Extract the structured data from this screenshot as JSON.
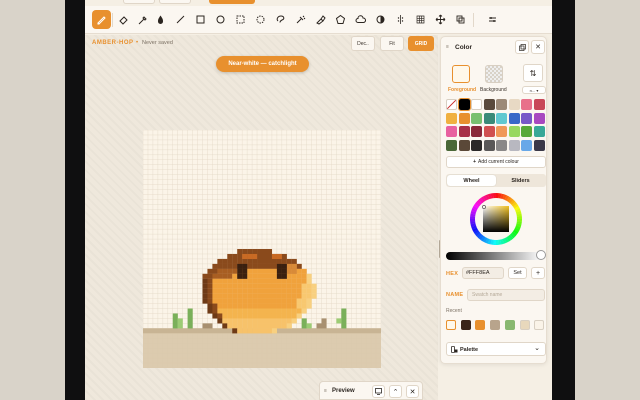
{
  "colors": {
    "accent": "#e8902e",
    "canvas_bg": "#fbf4e8",
    "ground": "#d8c6a8",
    "grid": "#e3d8c6"
  },
  "toolbar": {
    "tools": [
      {
        "name": "pencil-icon",
        "active": true
      },
      {
        "name": "eraser-icon"
      },
      {
        "name": "eyedropper-icon"
      },
      {
        "name": "fill-drop-icon"
      },
      {
        "name": "line-icon"
      },
      {
        "name": "rectangle-icon"
      },
      {
        "name": "circle-icon"
      },
      {
        "name": "select-rect-icon"
      },
      {
        "name": "select-ellipse-icon"
      },
      {
        "name": "lasso-icon"
      },
      {
        "name": "dither-brush-icon"
      },
      {
        "name": "smudge-icon"
      },
      {
        "name": "polygon-icon"
      },
      {
        "name": "cloud-shape-icon"
      },
      {
        "name": "contrast-icon"
      },
      {
        "name": "symmetry-icon"
      },
      {
        "name": "grid-pattern-icon"
      },
      {
        "name": "move-icon"
      },
      {
        "name": "layers-icon"
      },
      {
        "name": "adjust-icon"
      }
    ]
  },
  "document": {
    "title": "AMBER-HOP",
    "separator": "•",
    "status": "Never saved"
  },
  "view_buttons": {
    "dec": "Dec..",
    "fit": "Fit",
    "grid": "GRID"
  },
  "tooltip": {
    "text": "Near-white — catchlight"
  },
  "panel": {
    "title": "Color",
    "foreground_label": "Foreground",
    "background_label": "Background",
    "foreground_color": "#fff8ea",
    "mode_label": "n... ▾",
    "swatches": [
      "checker",
      "#000000",
      "#ffffff",
      "#5a4a3c",
      "#9c8a78",
      "#e8d9c4",
      "#e8708a",
      "#c84858",
      "#f0b040",
      "#e8902e",
      "#78c070",
      "#3a8a78",
      "#60c8d0",
      "#3868c8",
      "#7858c8",
      "#a848c0",
      "#e860a0",
      "#a83048",
      "#8a2838",
      "#d05050",
      "#f09858",
      "#98d860",
      "#58a838",
      "#38a898",
      "#4a6838",
      "#5a4838",
      "#2a2828",
      "#5a5858",
      "#8a8888",
      "#b8b8c0",
      "#68a8e8",
      "#3a3848"
    ],
    "add_colour_label": "Add current colour",
    "tabs": [
      {
        "label": "Wheel",
        "active": true
      },
      {
        "label": "Sliders",
        "active": false
      }
    ],
    "hex_label": "HEX",
    "hex_value": "#FFF8EA",
    "set_label": "Set",
    "plus_label": "+",
    "name_label": "NAME",
    "name_placeholder": "Swatch name",
    "recent_label": "Recent",
    "recent": [
      "#fff8ea",
      "#3a2418",
      "#e8902e",
      "#b8a48c",
      "#88b870",
      "#e8d8bc",
      "#faf3e8"
    ],
    "palette_label": "Palette",
    "palette_chevron": "⌄"
  },
  "preview": {
    "label": "Preview"
  }
}
